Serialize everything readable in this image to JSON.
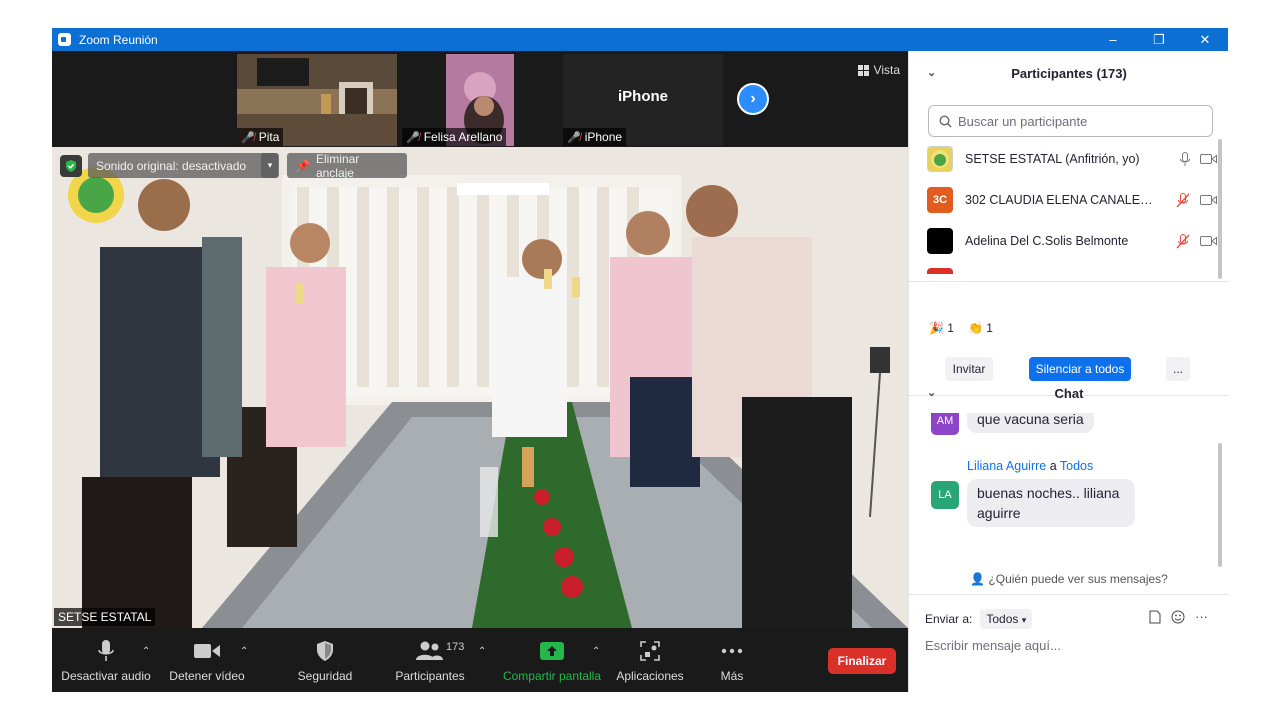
{
  "window": {
    "title": "Zoom Reunión",
    "controls": [
      "–",
      "❐",
      "✕"
    ]
  },
  "thumbnails": [
    {
      "name": "Pita",
      "mic_muted": true,
      "kind": "video"
    },
    {
      "name": "Felisa Arellano",
      "mic_muted": true,
      "kind": "video"
    },
    {
      "name": "iPhone",
      "mic_muted": true,
      "kind": "no-video",
      "center_label": "iPhone"
    }
  ],
  "view_button": {
    "label": "Vista"
  },
  "main_video": {
    "original_sound": "Sonido original: desactivado",
    "unpin": "Eliminar anclaje",
    "speaker": "SETSE ESTATAL"
  },
  "toolbar": {
    "mute": "Desactivar audio",
    "stop_video": "Detener vídeo",
    "security": "Seguridad",
    "participants": "Participantes",
    "participants_count": "173",
    "share": "Compartir pantalla",
    "apps": "Aplicaciones",
    "more": "Más",
    "end": "Finalizar"
  },
  "participants_panel": {
    "title": "Participantes (173)",
    "search_placeholder": "Buscar un participante",
    "list": [
      {
        "avatar_text": "",
        "avatar_color": "#e8d35a",
        "name": "SETSE ESTATAL (Anfitrión, yo)",
        "mic_muted": false
      },
      {
        "avatar_text": "3C",
        "avatar_color": "#e05c1f",
        "name": "302 CLAUDIA ELENA CANALES ...",
        "mic_muted": true
      },
      {
        "avatar_text": "",
        "avatar_color": "#000000",
        "name": "Adelina Del C.Solis Belmonte",
        "mic_muted": true
      }
    ],
    "reactions": [
      {
        "emoji": "🎉",
        "count": "1"
      },
      {
        "emoji": "👏",
        "count": "1"
      }
    ],
    "invite": "Invitar",
    "mute_all": "Silenciar a todos",
    "more": "..."
  },
  "chat_panel": {
    "title": "Chat",
    "messages": [
      {
        "initials": "AM",
        "color": "#8e44c8",
        "text": "que vacuna seria"
      },
      {
        "initials": "LA",
        "color": "#2aa577",
        "sender": "Liliana Aguirre",
        "connector": "a",
        "recipient": "Todos",
        "text_line1": "buenas noches.. liliana",
        "text_line2": "aguirre"
      }
    ],
    "who_sees": "¿Quién puede ver sus mensajes?",
    "send_to_label": "Enviar a:",
    "send_to_value": "Todos",
    "input_placeholder": "Escribir mensaje aquí..."
  },
  "colors": {
    "zoom_blue": "#0b6fd4",
    "end_red": "#d9302a",
    "share_green": "#23b84a",
    "link_blue": "#0e71eb"
  }
}
